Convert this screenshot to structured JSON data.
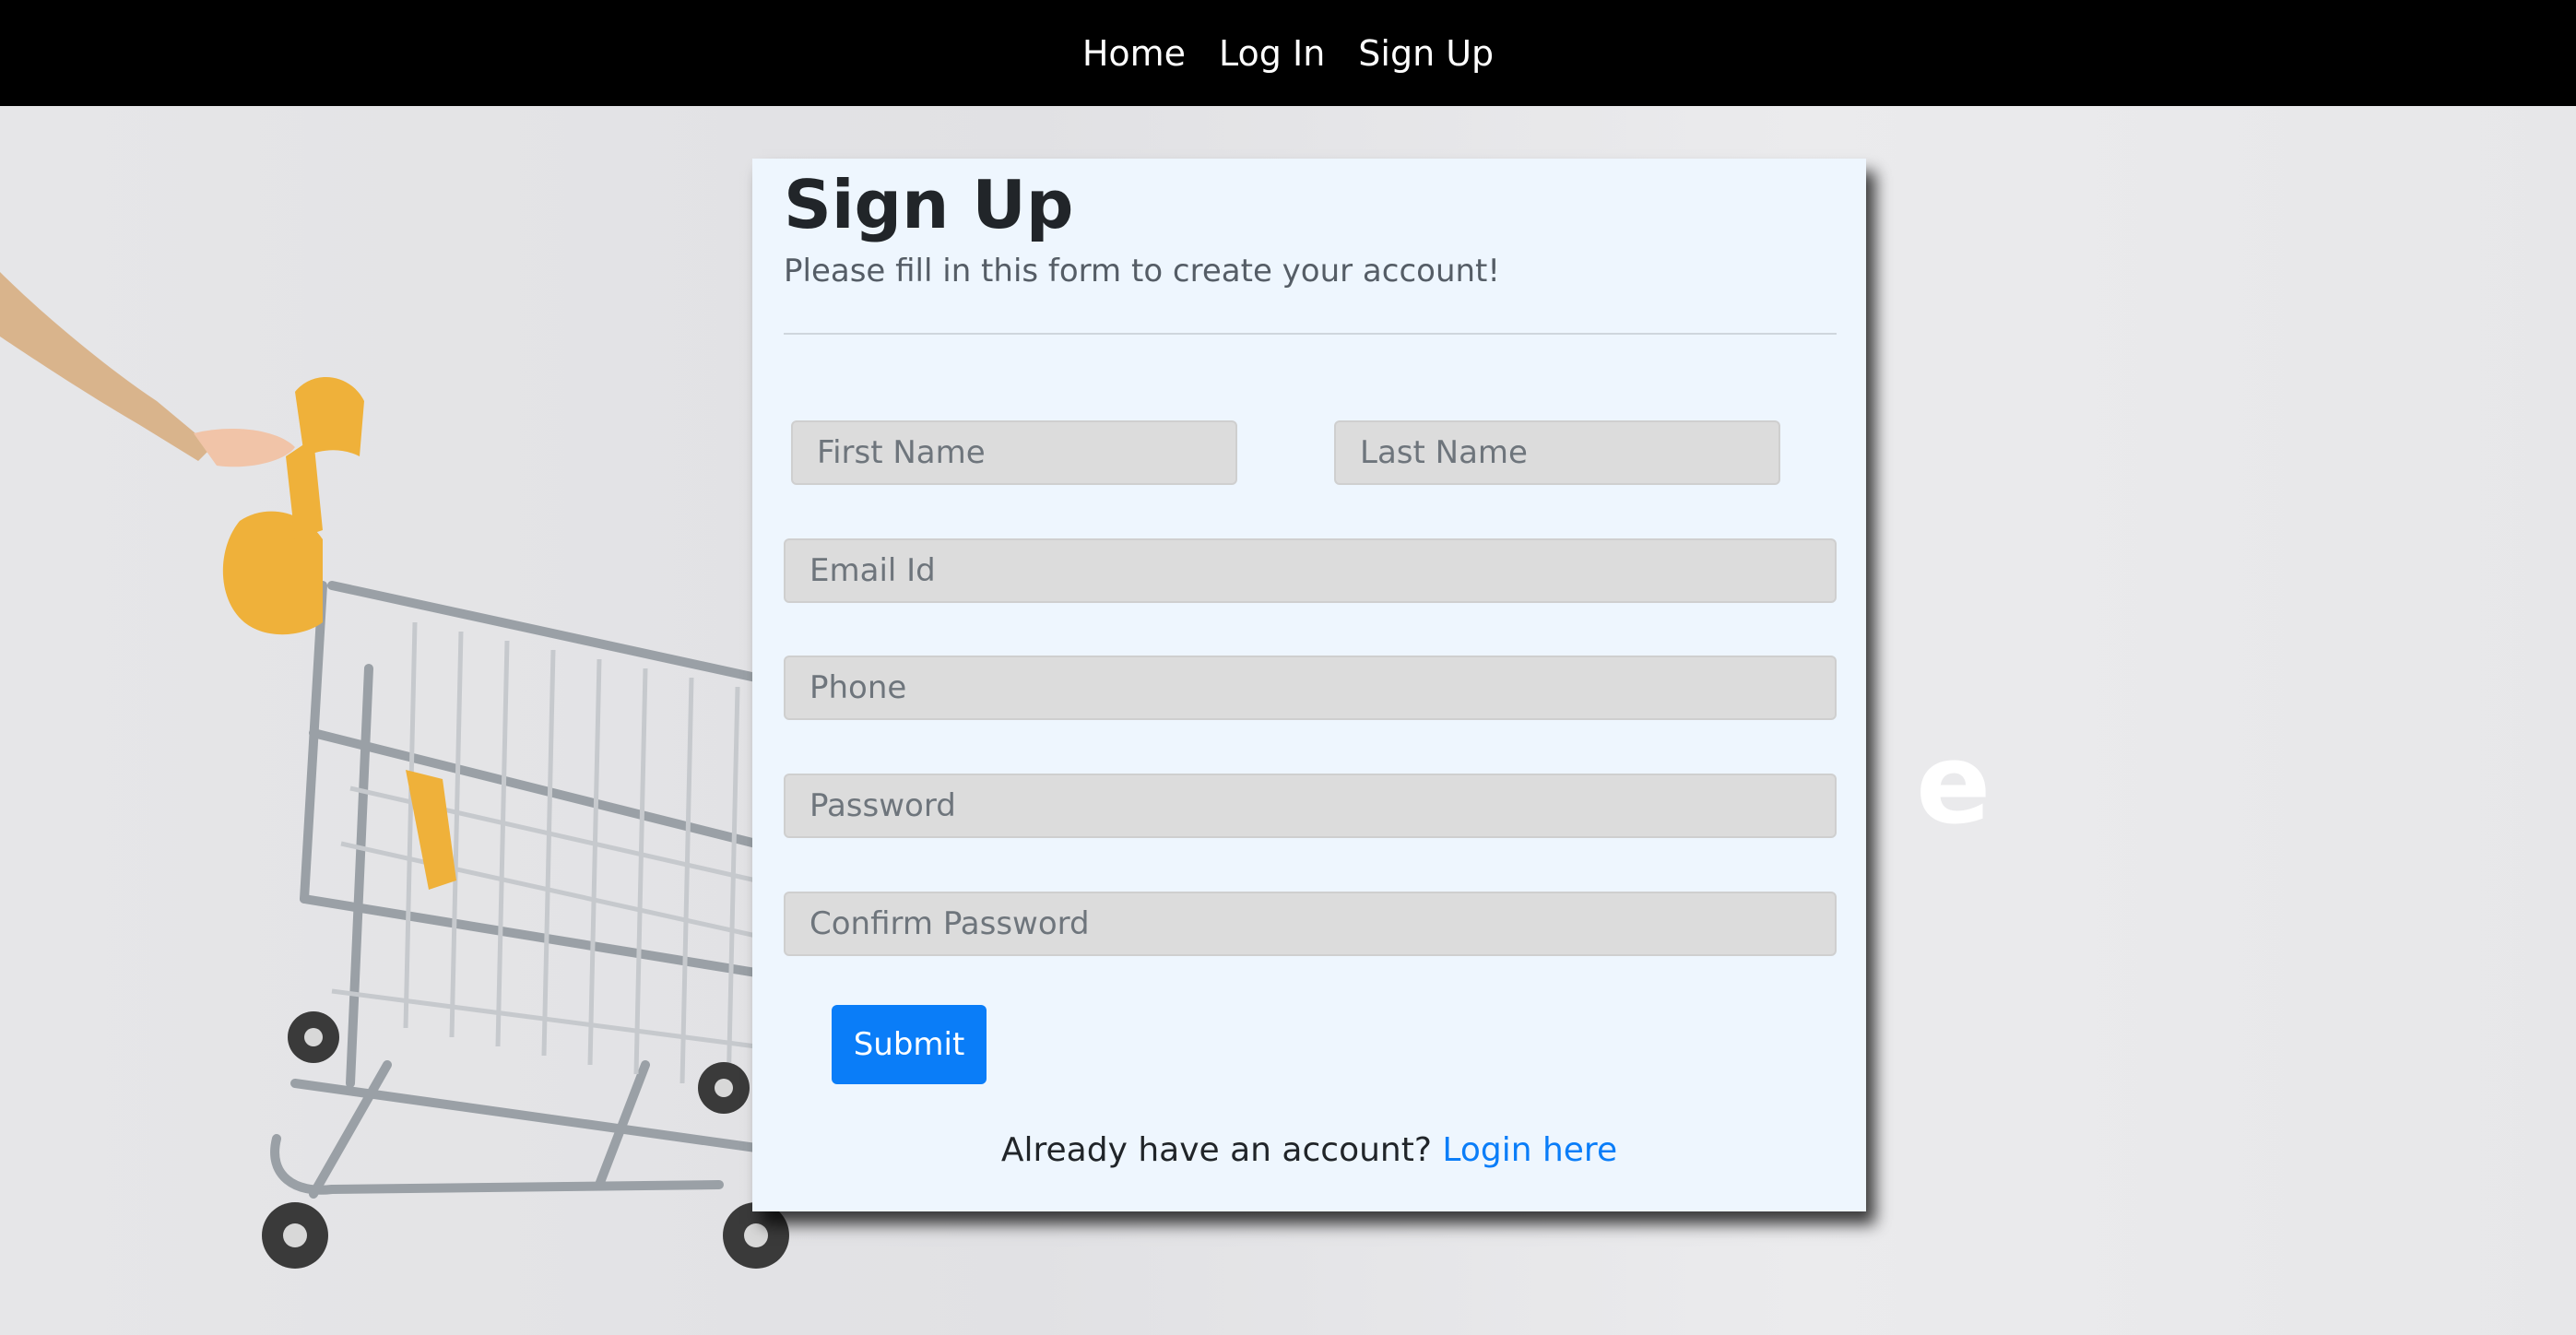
{
  "nav": {
    "items": [
      {
        "label": "Home"
      },
      {
        "label": "Log In"
      },
      {
        "label": "Sign Up"
      }
    ]
  },
  "hero": {
    "letter": "e",
    "image": "shopping-cart-illustration"
  },
  "form": {
    "title": "Sign Up",
    "subtitle": "Please fill in this form to create your account!",
    "fields": {
      "first_name": {
        "placeholder": "First Name",
        "value": ""
      },
      "last_name": {
        "placeholder": "Last Name",
        "value": ""
      },
      "email": {
        "placeholder": "Email Id",
        "value": ""
      },
      "phone": {
        "placeholder": "Phone",
        "value": ""
      },
      "password": {
        "placeholder": "Password",
        "value": ""
      },
      "confirm_password": {
        "placeholder": "Confirm Password",
        "value": ""
      }
    },
    "submit_label": "Submit",
    "login_prompt": "Already have an account?",
    "login_link": "Login here"
  },
  "colors": {
    "navbar": "#000000",
    "card": "#eef6fe",
    "primary": "#0a7df8",
    "input_bg": "#dcdcdc"
  }
}
